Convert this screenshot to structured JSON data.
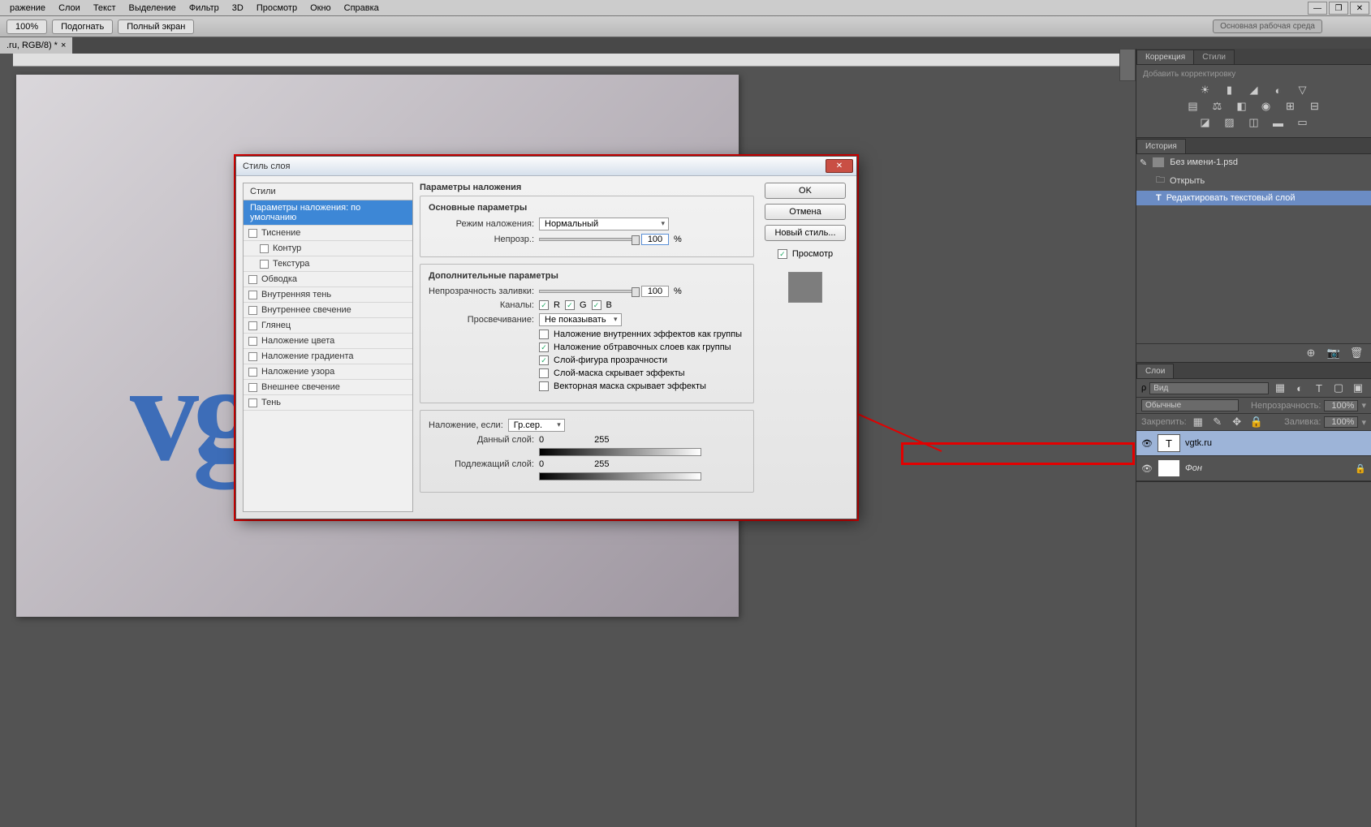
{
  "menu": [
    "ражение",
    "Слои",
    "Текст",
    "Выделение",
    "Фильтр",
    "3D",
    "Просмотр",
    "Окно",
    "Справка"
  ],
  "options": {
    "zoom": "100%",
    "fit": "Подогнать",
    "full": "Полный экран",
    "workspace": "Основная рабочая среда"
  },
  "doctab": ".ru, RGB/8) *",
  "canvas_text": "vg",
  "panels": {
    "adj_tabs": [
      "Коррекция",
      "Стили"
    ],
    "adj_hint": "Добавить корректировку",
    "history_tab": "История",
    "history_file": "Без имени-1.psd",
    "history_items": [
      "Открыть",
      "Редактировать текстовый слой"
    ],
    "layers_tab": "Слои",
    "kind": "Вид",
    "blend": "Обычные",
    "opacity_label": "Непрозрачность:",
    "opacity_val": "100%",
    "lock_label": "Закрепить:",
    "fill_label": "Заливка:",
    "fill_val": "100%",
    "layers": [
      {
        "name": "vgtk.ru",
        "type": "T",
        "sel": true
      },
      {
        "name": "Фон",
        "type": "bg",
        "sel": false
      }
    ]
  },
  "dialog": {
    "title": "Стиль слоя",
    "left_head": "Стили",
    "styles": [
      "Параметры наложения: по умолчанию",
      "Тиснение",
      "Контур",
      "Текстура",
      "Обводка",
      "Внутренняя тень",
      "Внутреннее свечение",
      "Глянец",
      "Наложение цвета",
      "Наложение градиента",
      "Наложение узора",
      "Внешнее свечение",
      "Тень"
    ],
    "center": {
      "heading": "Параметры наложения",
      "sub1": "Основные параметры",
      "mode_label": "Режим наложения:",
      "mode_val": "Нормальный",
      "opac_label": "Непрозр.:",
      "opac_val": "100",
      "pct": "%",
      "sub2": "Дополнительные параметры",
      "fillopac_label": "Непрозрачность заливки:",
      "fillopac_val": "100",
      "channels_label": "Каналы:",
      "ch_r": "R",
      "ch_g": "G",
      "ch_b": "B",
      "knockout_label": "Просвечивание:",
      "knockout_val": "Не показывать",
      "cb1": "Наложение внутренних эффектов как группы",
      "cb2": "Наложение обтравочных слоев как группы",
      "cb3": "Слой-фигура прозрачности",
      "cb4": "Слой-маска скрывает эффекты",
      "cb5": "Векторная маска скрывает эффекты",
      "blendif_label": "Наложение, если:",
      "blendif_val": "Гр.сер.",
      "this_label": "Данный слой:",
      "under_label": "Подлежащий слой:",
      "range0": "0",
      "range255": "255"
    },
    "buttons": {
      "ok": "OK",
      "cancel": "Отмена",
      "newstyle": "Новый стиль...",
      "preview": "Просмотр"
    }
  }
}
